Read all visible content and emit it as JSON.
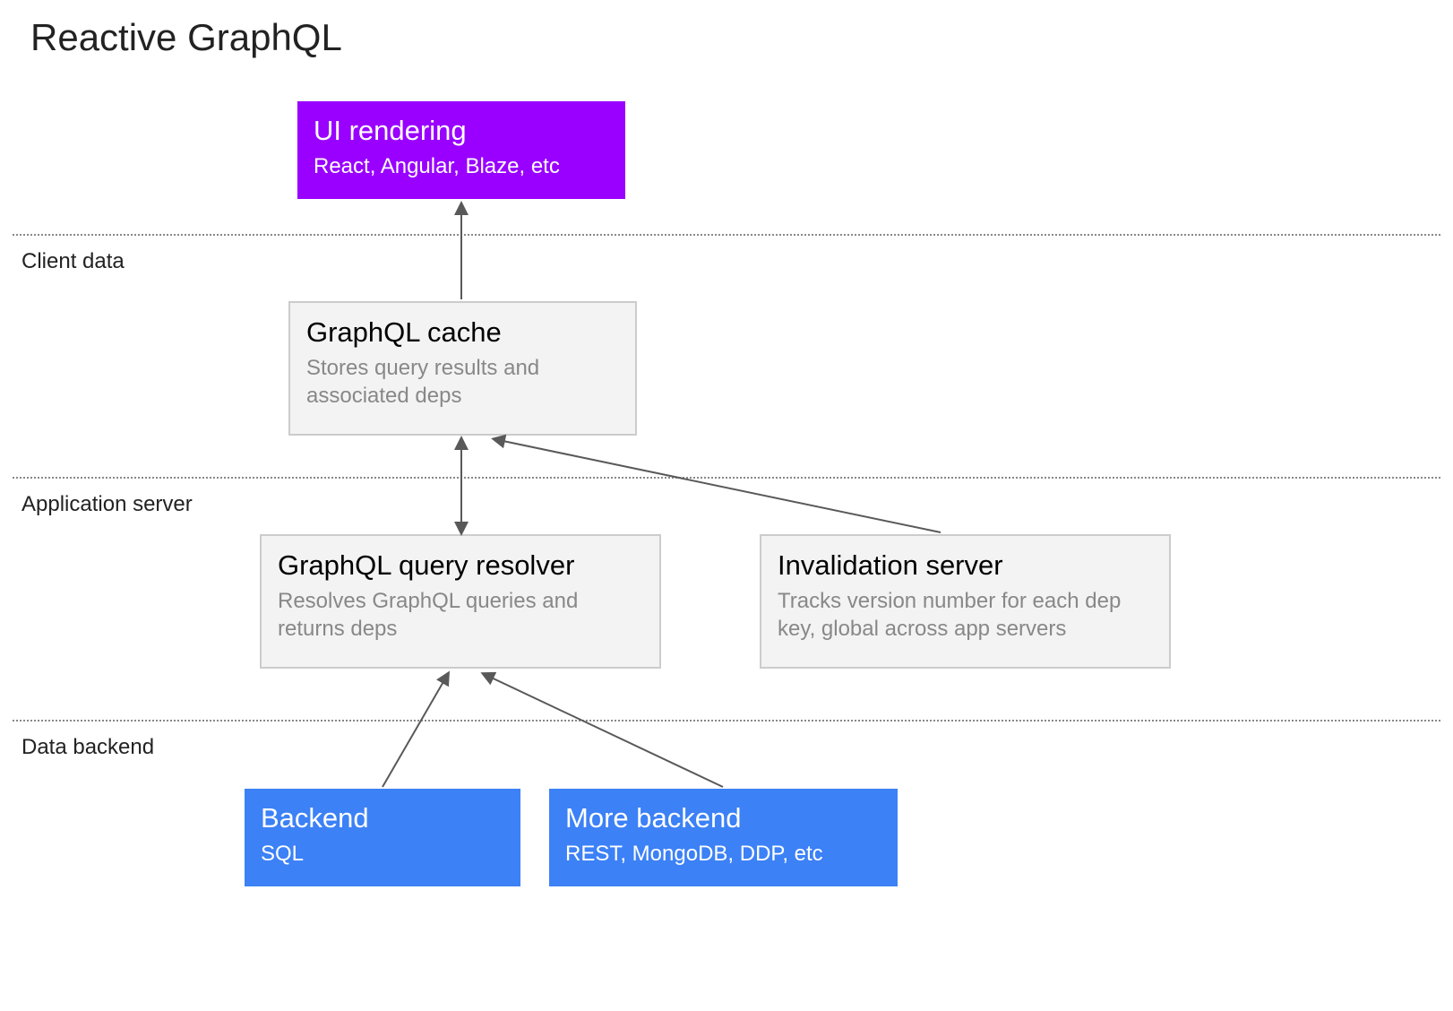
{
  "title": "Reactive GraphQL",
  "sections": {
    "client_data": "Client data",
    "application_server": "Application server",
    "data_backend": "Data backend"
  },
  "boxes": {
    "ui_rendering": {
      "title": "UI rendering",
      "sub": "React, Angular, Blaze, etc"
    },
    "graphql_cache": {
      "title": "GraphQL cache",
      "sub": "Stores query results and associated deps"
    },
    "graphql_resolver": {
      "title": "GraphQL query resolver",
      "sub": "Resolves GraphQL queries and returns deps"
    },
    "invalidation_server": {
      "title": "Invalidation server",
      "sub": "Tracks version number for each dep key, global across app servers"
    },
    "backend": {
      "title": "Backend",
      "sub": "SQL"
    },
    "more_backend": {
      "title": "More backend",
      "sub": "REST, MongoDB, DDP, etc"
    }
  },
  "colors": {
    "purple": "#9900ff",
    "blue": "#3c81f6",
    "grey_bg": "#f3f3f3",
    "grey_border": "#cccccc",
    "grey_text": "#888888"
  }
}
